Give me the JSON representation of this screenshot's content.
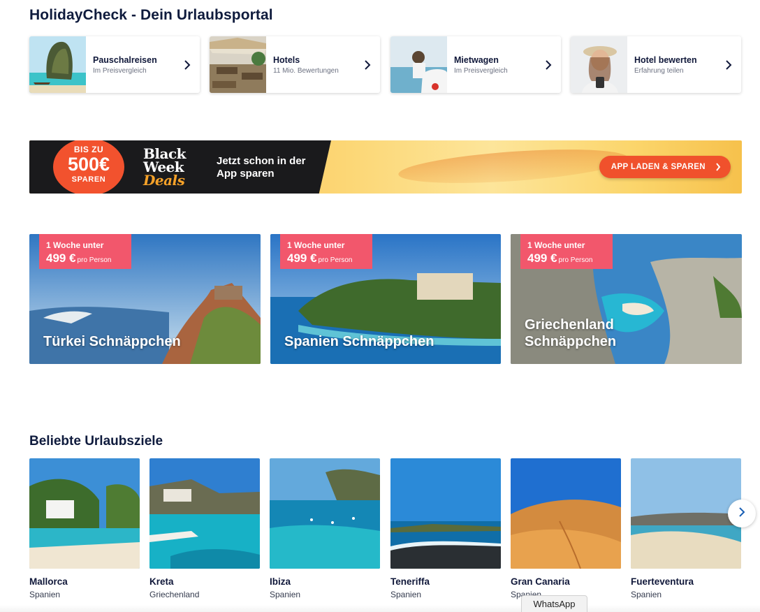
{
  "page": {
    "title": "HolidayCheck - Dein Urlaubsportal"
  },
  "categories": [
    {
      "title": "Pauschalreisen",
      "subtitle": "Im Preisvergleich"
    },
    {
      "title": "Hotels",
      "subtitle": "11 Mio. Bewertungen"
    },
    {
      "title": "Mietwagen",
      "subtitle": "Im Preisvergleich"
    },
    {
      "title": "Hotel bewerten",
      "subtitle": "Erfahrung teilen"
    }
  ],
  "banner": {
    "badge_top": "BIS ZU",
    "badge_amount": "500€",
    "badge_bottom": "SPAREN",
    "logo_line1": "Black",
    "logo_line2": "Week",
    "logo_line3": "Deals",
    "text": "Jetzt schon in der App sparen",
    "cta": "APP LADEN & SPAREN"
  },
  "deals": [
    {
      "tag_line": "1 Woche unter",
      "price": "499 €",
      "price_unit": "pro Person",
      "title": "Türkei Schnäppchen"
    },
    {
      "tag_line": "1 Woche unter",
      "price": "499 €",
      "price_unit": "pro Person",
      "title": "Spanien Schnäppchen"
    },
    {
      "tag_line": "1 Woche unter",
      "price": "499 €",
      "price_unit": "pro Person",
      "title": "Griechenland Schnäppchen"
    }
  ],
  "popular": {
    "title": "Beliebte Urlaubsziele",
    "items": [
      {
        "name": "Mallorca",
        "country": "Spanien"
      },
      {
        "name": "Kreta",
        "country": "Griechenland"
      },
      {
        "name": "Ibiza",
        "country": "Spanien"
      },
      {
        "name": "Teneriffa",
        "country": "Spanien"
      },
      {
        "name": "Gran Canaria",
        "country": "Spanien"
      },
      {
        "name": "Fuerteventura",
        "country": "Spanien"
      }
    ]
  },
  "whatsapp": {
    "label": "WhatsApp"
  },
  "colors": {
    "brand_dark": "#0f1b3d",
    "deal_tag": "#f2576c",
    "cta": "#f0512c"
  }
}
